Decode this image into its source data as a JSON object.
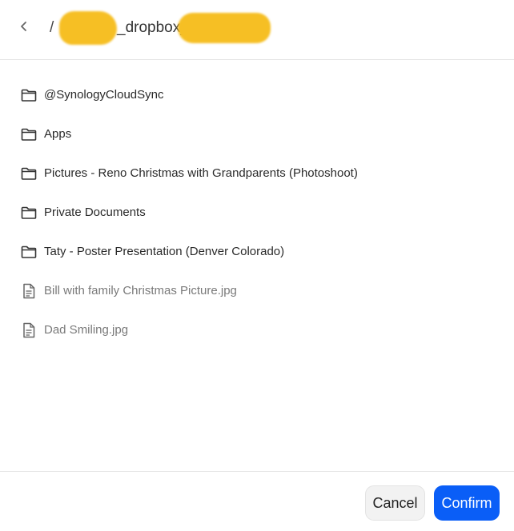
{
  "header": {
    "back_icon": "chevron-left-icon",
    "separator": "/",
    "path_visible": "_dropbox_1"
  },
  "items": [
    {
      "type": "folder",
      "icon": "folder-icon",
      "label": "@SynologyCloudSync"
    },
    {
      "type": "folder",
      "icon": "folder-icon",
      "label": "Apps"
    },
    {
      "type": "folder",
      "icon": "folder-icon",
      "label": "Pictures - Reno Christmas with Grandparents (Photoshoot)"
    },
    {
      "type": "folder",
      "icon": "folder-icon",
      "label": "Private Documents"
    },
    {
      "type": "folder",
      "icon": "folder-icon",
      "label": "Taty - Poster Presentation (Denver Colorado)"
    },
    {
      "type": "file",
      "icon": "file-icon",
      "label": "Bill with family Christmas Picture.jpg"
    },
    {
      "type": "file",
      "icon": "file-icon",
      "label": "Dad Smiling.jpg"
    }
  ],
  "footer": {
    "cancel_label": "Cancel",
    "confirm_label": "Confirm"
  },
  "colors": {
    "accent": "#0a5ef7",
    "redaction": "#f6bf24",
    "divider": "#e6e6e6"
  }
}
